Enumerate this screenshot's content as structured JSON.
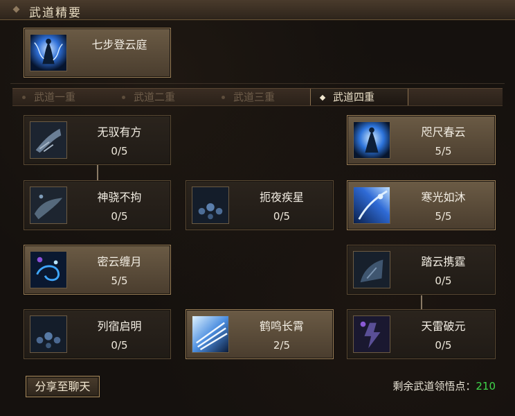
{
  "window": {
    "title": "武道精要"
  },
  "header_skill": {
    "name": "七步登云庭"
  },
  "tabs": [
    {
      "label": "武道一重",
      "active": false
    },
    {
      "label": "武道二重",
      "active": false
    },
    {
      "label": "武道三重",
      "active": false
    },
    {
      "label": "武道四重",
      "active": true
    }
  ],
  "skills": [
    {
      "name": "无驭有方",
      "level": "0/5",
      "active": false,
      "icon": "ice-claw-icon"
    },
    {
      "name": "咫尺春云",
      "level": "5/5",
      "active": true,
      "icon": "blue-aura-figure-icon"
    },
    {
      "name": "神骁不拘",
      "level": "0/5",
      "active": false,
      "icon": "wind-beast-icon"
    },
    {
      "name": "扼夜疾星",
      "level": "0/5",
      "active": false,
      "icon": "star-orbs-icon"
    },
    {
      "name": "寒光如沐",
      "level": "5/5",
      "active": true,
      "icon": "blue-light-arc-icon"
    },
    {
      "name": "密云缠月",
      "level": "5/5",
      "active": true,
      "icon": "swirl-moon-icon"
    },
    {
      "name": "踏云携霆",
      "level": "0/5",
      "active": false,
      "icon": "cloud-stride-icon"
    },
    {
      "name": "列宿启明",
      "level": "0/5",
      "active": false,
      "icon": "star-orbs-icon"
    },
    {
      "name": "鹤鸣长霄",
      "level": "2/5",
      "active": true,
      "icon": "crane-wing-icon"
    },
    {
      "name": "天雷破元",
      "level": "0/5",
      "active": false,
      "icon": "thunder-warrior-icon"
    }
  ],
  "footer": {
    "share_label": "分享至聊天",
    "points_label": "剩余武道领悟点：",
    "points_value": "210"
  },
  "colors": {
    "accent_border": "#9c8058",
    "points_green": "#3fd64b",
    "title_text": "#e9ddc3"
  }
}
